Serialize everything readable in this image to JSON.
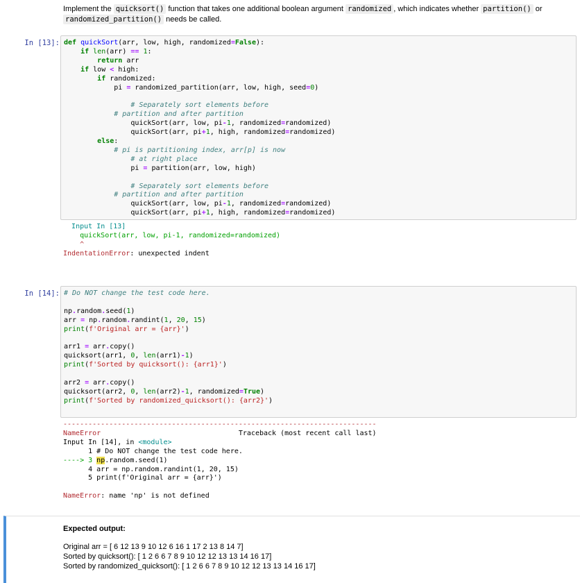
{
  "markdown_top": {
    "t1": "Implement the ",
    "c1": "quicksort()",
    "t2": " function that takes one additional boolean argument ",
    "c2": "randomized",
    "t3": ", which indicates whether ",
    "c3": "partition()",
    "t4": " or",
    "c4": "randomized_partition()",
    "t5": " needs be called."
  },
  "cell13": {
    "prompt": "In [13]:",
    "error_location": "Input In [13]",
    "error_code_line": "    quickSort(arr, low, pi-1, randomized=randomized)",
    "caret": "    ^",
    "error_name": "IndentationError",
    "error_message": ": unexpected indent"
  },
  "cell14": {
    "prompt": "In [14]:",
    "dashes": "---------------------------------------------------------------------------",
    "error_name": "NameError",
    "traceback_label": "Traceback (most recent call last)",
    "input_label": "Input In [14], in ",
    "module": "<module>",
    "tb_line1": "      1 # Do NOT change the test code here.",
    "tb_arrow": "----> 3 ",
    "tb_hl": "np",
    "tb_line3_rest": ".random.seed(1)",
    "tb_line4": "      4 arr = np.random.randint(1, 20, 15)",
    "tb_line5": "      5 print(f'Original arr = {arr}')",
    "final_error_name": "NameError",
    "final_error_message": ": name 'np' is not defined"
  },
  "expected": {
    "heading": "Expected output:",
    "line1": "Original arr = [ 6 12 13  9 10 12  6 16  1 17  2 13  8 14  7]",
    "line2": "Sorted by quicksort(): [ 1  2  6  6  7  8  9 10 12 12 13 13 14 16 17]",
    "line3": "Sorted by randomized_quicksort(): [ 1  2  6  6  7  8  9 10 12 12 13 13 14 16 17]"
  },
  "colors": {
    "prompt": "#303f9f",
    "error": "#b22b31",
    "accent_bar": "#4a90d9",
    "cell_bg": "#f7f7f7"
  }
}
